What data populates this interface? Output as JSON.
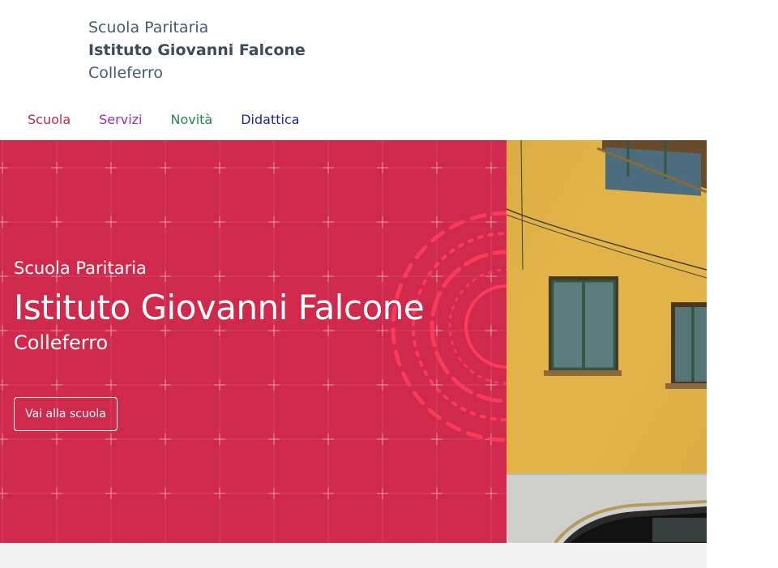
{
  "brand": {
    "line1": "Scuola Paritaria",
    "name": "Istituto Giovanni Falcone",
    "city": "Colleferro"
  },
  "nav": [
    {
      "label": "Scuola",
      "color": "#c0284a"
    },
    {
      "label": "Servizi",
      "color": "#a12bc6"
    },
    {
      "label": "Novità",
      "color": "#1f8a54"
    },
    {
      "label": "Didattica",
      "color": "#1d1fa8"
    }
  ],
  "hero": {
    "subtitle": "Scuola Paritaria",
    "title": "Istituto Giovanni Falcone",
    "city": "Colleferro",
    "button_label": "Vai alla scuola",
    "accent_color": "#cf2a4b"
  }
}
